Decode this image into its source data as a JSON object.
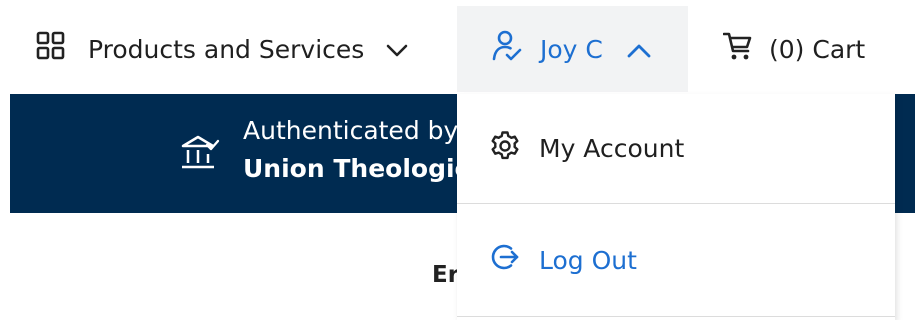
{
  "nav": {
    "products_label": "Products and Services",
    "user_label": "Joy C",
    "cart_label": "(0) Cart"
  },
  "banner": {
    "line1": "Authenticated by",
    "line2": "Union Theological"
  },
  "main": {
    "partial_heading": "Er"
  },
  "dropdown": {
    "items": [
      {
        "label": "My Account",
        "icon": "gear-icon"
      },
      {
        "label": "Log Out",
        "icon": "logout-icon"
      }
    ]
  },
  "colors": {
    "accent": "#1d6fd1",
    "banner_bg": "#002b51",
    "active_bg": "#f2f3f4"
  }
}
